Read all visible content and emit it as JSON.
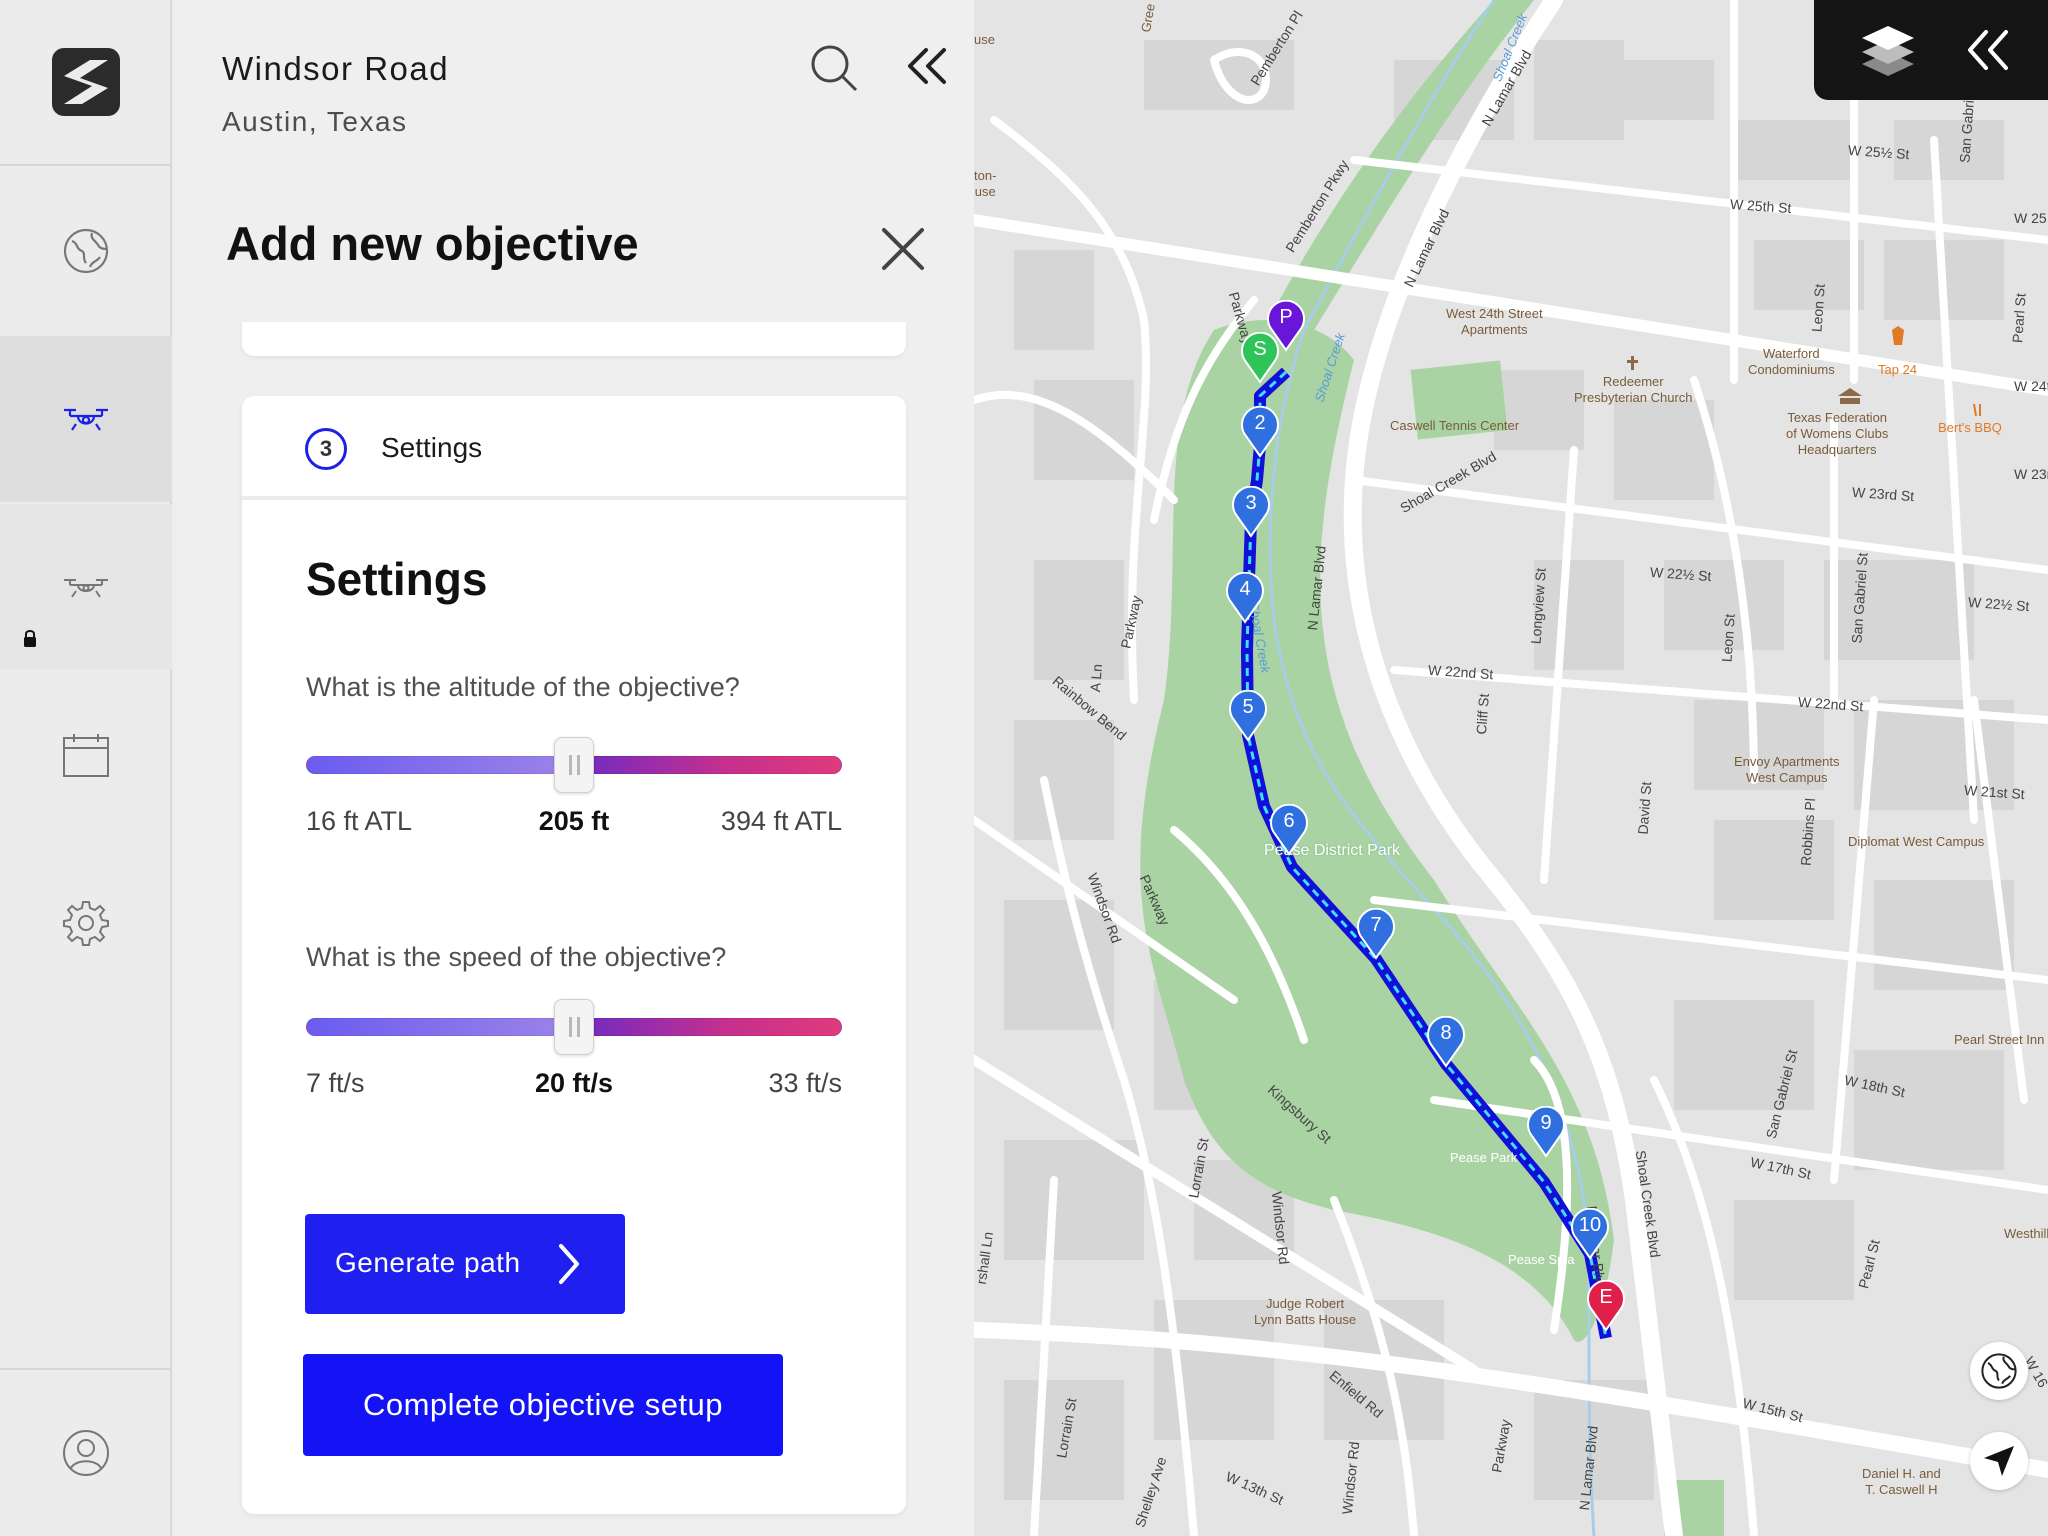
{
  "location": {
    "title": "Windsor Road",
    "subtitle": "Austin, Texas"
  },
  "objective": {
    "title": "Add new objective"
  },
  "step": {
    "number": "3",
    "label": "Settings"
  },
  "settings": {
    "heading": "Settings",
    "altitude": {
      "question": "What is the altitude of the objective?",
      "min_label": "16 ft ATL",
      "max_label": "394 ft ATL",
      "current_label": "205 ft",
      "min": 16,
      "max": 394,
      "value": 205
    },
    "speed": {
      "question": "What is the speed of the objective?",
      "min_label": "7 ft/s",
      "max_label": "33 ft/s",
      "current_label": "20 ft/s",
      "min": 7,
      "max": 33,
      "value": 20
    }
  },
  "buttons": {
    "generate": "Generate path",
    "complete": "Complete objective setup"
  },
  "rail_icons": [
    "logo-icon",
    "globe-icon",
    "drone-icon",
    "drone-locked-icon",
    "calendar-icon",
    "gear-icon",
    "profile-icon"
  ],
  "colors": {
    "accent": "#1f1fef",
    "complete": "#1313f5",
    "waypoint": "#2f6fe0",
    "start": "#2ec45a",
    "park_marker": "#6a16d8",
    "end": "#e0204a",
    "park": "#a9d3a3"
  },
  "map": {
    "waypoints": [
      {
        "label": "P"
      },
      {
        "label": "S"
      },
      {
        "label": "2"
      },
      {
        "label": "3"
      },
      {
        "label": "4"
      },
      {
        "label": "5"
      },
      {
        "label": "6"
      },
      {
        "label": "7"
      },
      {
        "label": "8"
      },
      {
        "label": "9"
      },
      {
        "label": "10"
      },
      {
        "label": "E"
      }
    ],
    "labels": {
      "park": "Pease District Park",
      "creek1": "Shoal Creek",
      "creek2": "Shoal Creek",
      "creek3": "Shoal Creek",
      "lamar1": "N Lamar Blvd",
      "lamar2": "N Lamar Blvd",
      "lamar3": "N Lamar Blvd",
      "lamar4": "N Lamar Blvd",
      "lamar5": "N Lamar Blvd",
      "w25half": "W 25½ St",
      "w25": "W 25th St",
      "w24": "W 24t",
      "w23": "W 23r",
      "w23rd": "W 23rd St",
      "w22half": "W 22½ St",
      "w22half2": "W 22½ St",
      "w22nd": "W 22nd St",
      "w22nd2": "W 22nd St",
      "w21": "W 21st St",
      "w18": "W 18th St",
      "w17": "W 17th St",
      "w15": "W 15th St",
      "w16": "W 16",
      "w13": "W 13th St",
      "w25b": "W 25",
      "pemberton_pl": "Pemberton Pl",
      "pemberton_pkwy": "Pemberton Pkwy",
      "parkway1": "Parkway",
      "parkway2": "Parkway",
      "parkway3": "Parkway",
      "parkway4": "Parkway",
      "shoal_creek_blvd": "Shoal Creek Blvd",
      "shoal_creek_blvd2": "Shoal Creek Blvd",
      "leon": "Leon St",
      "leon2": "Leon St",
      "longview": "Longview St",
      "cliff": "Cliff St",
      "david": "David St",
      "robbins": "Robbins Pl",
      "san_gabriel": "San Gabriel St",
      "san_gabriel2": "San Gabriel St",
      "san_gabriel3": "San Gabriel",
      "pearl": "Pearl St",
      "pearl2": "Pearl St",
      "rainbow": "Rainbow Bend",
      "a_ln": "A Ln",
      "windsor": "Windsor Rd",
      "windsor2": "Windsor Rd",
      "windsor3": "Windsor Rd",
      "kingsbury": "Kingsbury St",
      "lorrain": "Lorrain St",
      "lorrain2": "Lorrain St",
      "enfield": "Enfield Rd",
      "shelley": "Shelley Ave",
      "marshall": "rshall Ln",
      "west24": "West 24th Street\nApartments",
      "caswell": "Caswell Tennis Center",
      "redeemer": "Redeemer\nPresbyterian Church",
      "waterford": "Waterford\nCondominiums",
      "tap24": "Tap 24",
      "txfed": "Texas Federation\nof Womens Clubs\nHeadquarters",
      "berts": "Bert's BBQ",
      "envoy": "Envoy Apartments\nWest Campus",
      "diplomat": "Diplomat West Campus",
      "pearlinn": "Pearl Street Inn",
      "westhill": "Westhill",
      "judge": "Judge Robert\nLynn Batts House",
      "caswellhouse": "Daniel H. and\nT. Caswell H",
      "peasepark": "Pease Park",
      "peasesplash": "Pease Spla",
      "grec": "Gree",
      "ton": "ton-\nuse",
      "use": "use"
    }
  }
}
